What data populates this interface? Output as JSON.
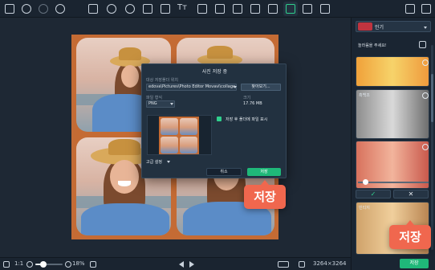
{
  "toolbar": {
    "left_icons": [
      "menu-icon",
      "undo-icon",
      "redo-icon",
      "reset-icon"
    ],
    "tool_icons": [
      "adjust-icon",
      "enhance-icon",
      "retouch-icon",
      "crop-icon",
      "object-removal-icon",
      "text-icon",
      "layers-icon",
      "watermark-icon",
      "magic-brush-icon",
      "insert-picture-icon",
      "frame-icon",
      "collage-icon",
      "effects-icon",
      "compare-icon"
    ],
    "text_tool_label": "Tт"
  },
  "status_bar": {
    "fit_label": "1:1",
    "zoom_percent": "18%",
    "dimensions": "3264×3264"
  },
  "dialog": {
    "title": "사진 저장 중",
    "folder_label": "대상 저장폴더 위치",
    "folder_path": "edova\\Pictures\\Photo Editor Movavi\\collage",
    "browse_button": "찾아보기...",
    "format_label": "파일 형식",
    "format_value": "PNG",
    "size_label": "크기",
    "size_value": "17.76 MB",
    "open_folder_label": "저장 후 폴더에 파일 표시",
    "open_folder_checked": true,
    "advanced_label": "고급 설정",
    "cancel_button": "취소",
    "save_button": "저장"
  },
  "callouts": {
    "dialog_save": "저장",
    "panel_save": "저장"
  },
  "panel": {
    "category": "인기",
    "hint": "놀라움을 주세요!",
    "cards": [
      {
        "label": "",
        "favorite": true
      },
      {
        "label": "흑백조",
        "favorite": true
      },
      {
        "label": "",
        "favorite": true
      },
      {
        "label": "빈티지",
        "favorite": false
      }
    ],
    "intensity": 0.1,
    "apply_label": "✓",
    "discard_label": "✕",
    "save_button": "저장"
  },
  "colors": {
    "accent": "#1fb879",
    "callout": "#f0674e",
    "collage_bg": "#c46b34"
  }
}
